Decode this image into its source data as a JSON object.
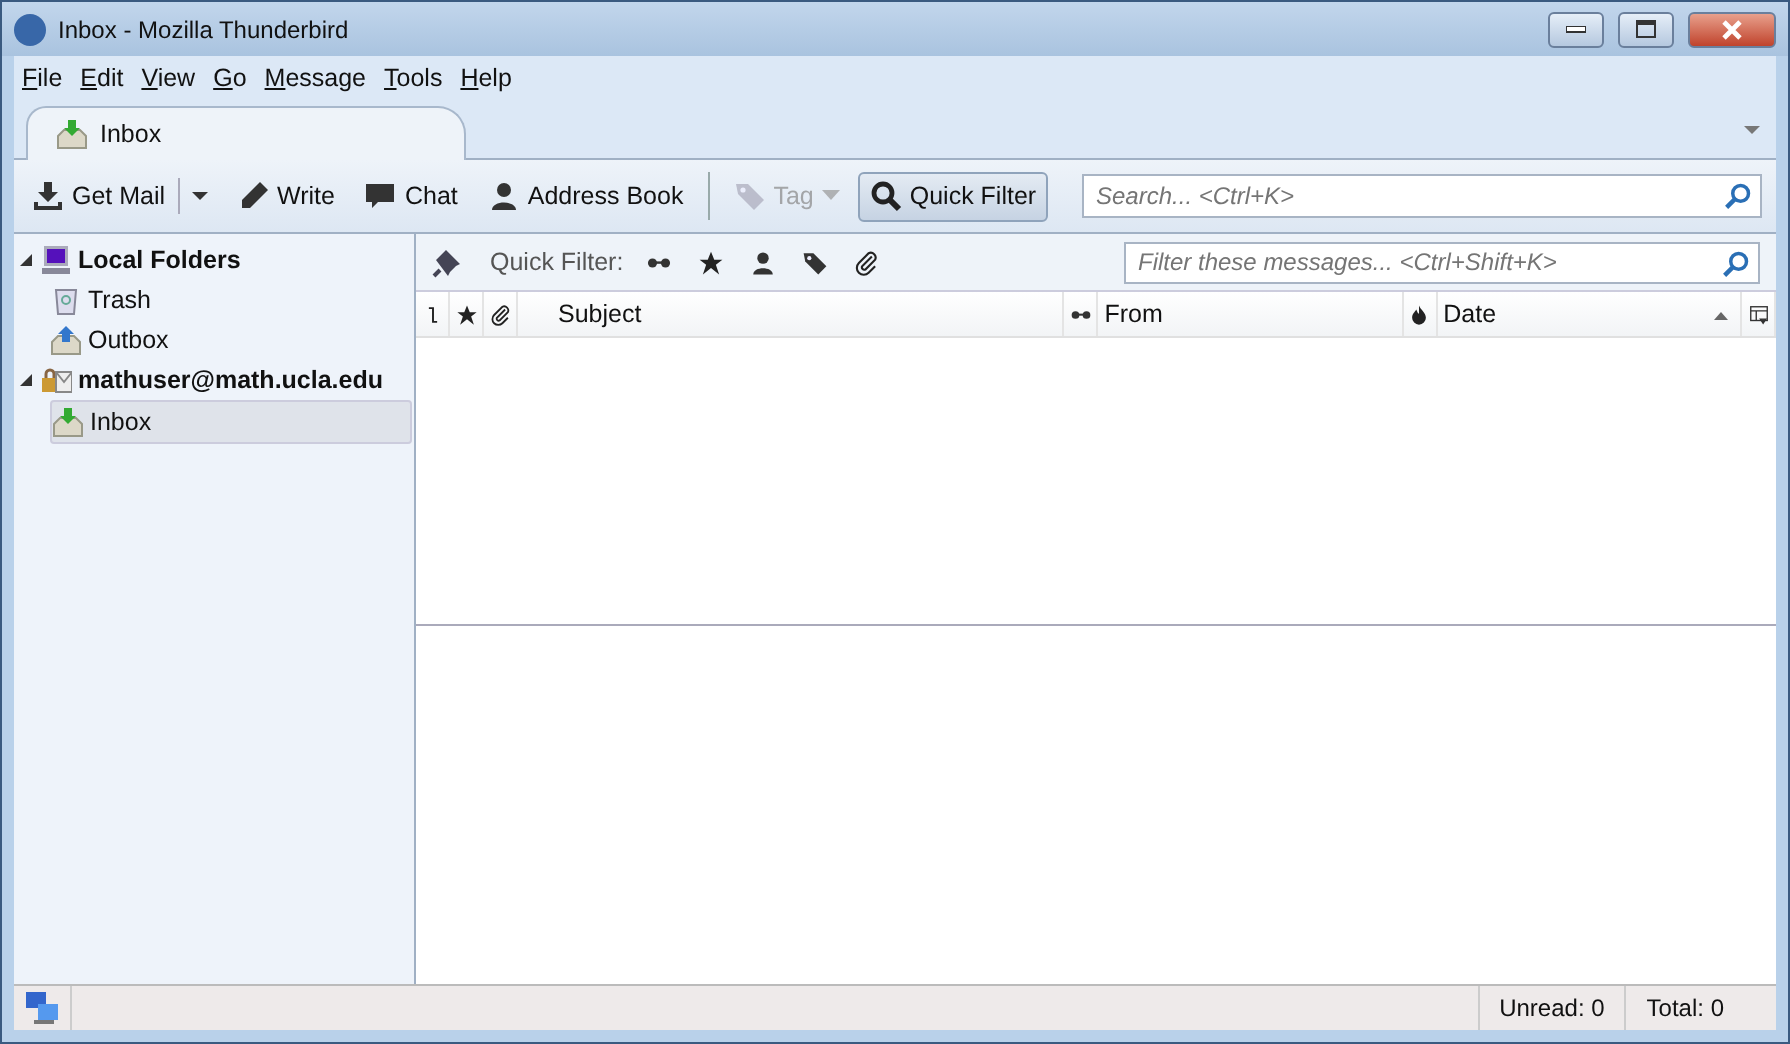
{
  "window": {
    "title": "Inbox - Mozilla Thunderbird"
  },
  "menu": [
    "File",
    "Edit",
    "View",
    "Go",
    "Message",
    "Tools",
    "Help"
  ],
  "tabs": [
    {
      "label": "Inbox",
      "selected": true
    }
  ],
  "toolbar": [
    {
      "kind": "split",
      "label": "Get Mail",
      "disabled": false,
      "pressed": false
    },
    {
      "kind": "button",
      "label": "Write",
      "disabled": false,
      "pressed": false
    },
    {
      "kind": "button",
      "label": "Chat",
      "disabled": false,
      "pressed": false
    },
    {
      "kind": "button",
      "label": "Address Book",
      "disabled": false,
      "pressed": false
    },
    {
      "kind": "separator"
    },
    {
      "kind": "menu",
      "label": "Tag",
      "disabled": true,
      "pressed": false
    },
    {
      "kind": "button",
      "label": "Quick Filter",
      "disabled": false,
      "pressed": true
    }
  ],
  "search": {
    "placeholder": "Search... <Ctrl+K>"
  },
  "folders": [
    {
      "label": "Local Folders",
      "expanded": true,
      "children": [
        {
          "label": "Trash",
          "selected": false
        },
        {
          "label": "Outbox",
          "selected": false
        }
      ]
    },
    {
      "label": "mathuser@math.ucla.edu",
      "expanded": true,
      "children": [
        {
          "label": "Inbox",
          "selected": true
        }
      ]
    }
  ],
  "quick_filter": {
    "label": "Quick Filter:",
    "placeholder": "Filter these messages... <Ctrl+Shift+K>"
  },
  "table": {
    "columns": [
      {
        "kind": "icon"
      },
      {
        "kind": "icon"
      },
      {
        "kind": "icon"
      },
      {
        "kind": "text",
        "label": "Subject",
        "sorted": false
      },
      {
        "kind": "icon"
      },
      {
        "kind": "text",
        "label": "From",
        "sorted": false
      },
      {
        "kind": "icon"
      },
      {
        "kind": "text",
        "label": "Date",
        "sorted": true
      },
      {
        "kind": "icon"
      }
    ]
  },
  "status_bar": {
    "unread": "Unread: 0",
    "total": "Total: 0"
  }
}
